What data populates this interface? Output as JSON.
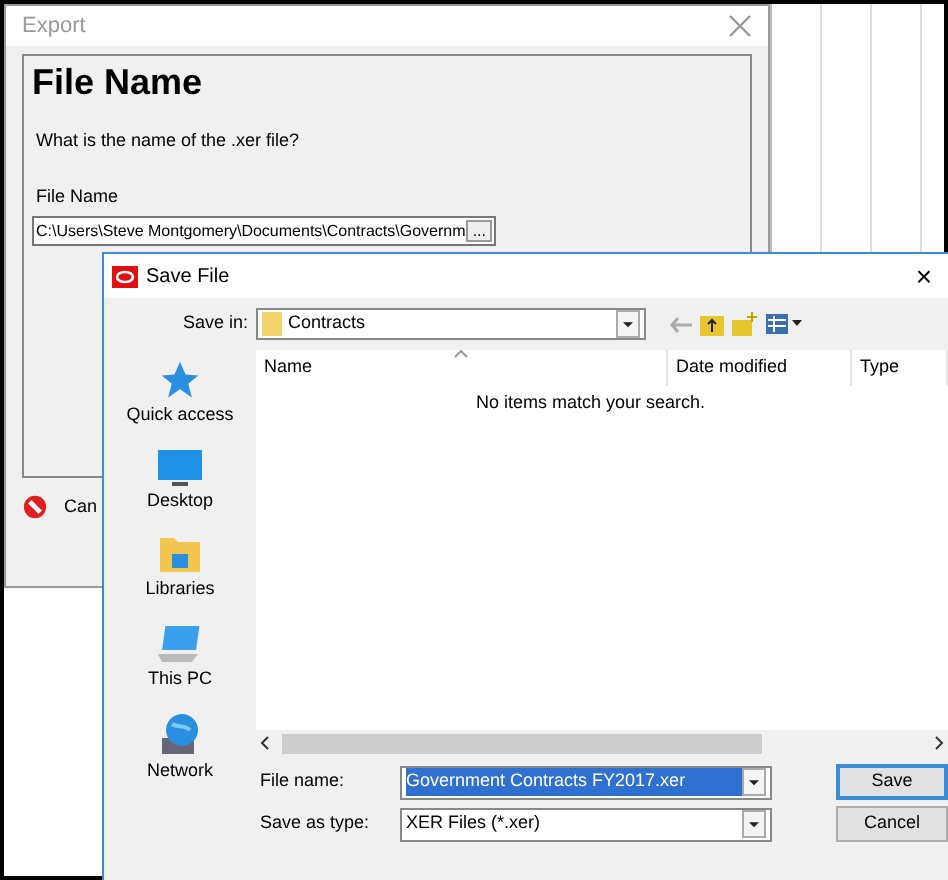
{
  "export_dialog": {
    "title": "Export",
    "heading": "File Name",
    "question": "What is the name of the .xer file?",
    "field_label": "File Name",
    "field_value": "C:\\Users\\Steve Montgomery\\Documents\\Contracts\\Governm",
    "browse_label": "...",
    "cancel_label": "Can"
  },
  "save_dialog": {
    "title": "Save File",
    "close": "×",
    "save_in_label": "Save in:",
    "save_in_value": "Contracts",
    "places": [
      {
        "kind": "star",
        "label": "Quick access"
      },
      {
        "kind": "desktop",
        "label": "Desktop"
      },
      {
        "kind": "libraries",
        "label": "Libraries"
      },
      {
        "kind": "pc",
        "label": "This PC"
      },
      {
        "kind": "network",
        "label": "Network"
      }
    ],
    "columns": [
      "Name",
      "Date modified",
      "Type"
    ],
    "empty_message": "No items match your search.",
    "file_name_label": "File name:",
    "file_name_value": "Government Contracts FY2017.xer",
    "type_label": "Save as type:",
    "type_value": "XER Files (*.xer)",
    "buttons": [
      "Save",
      "Cancel"
    ]
  }
}
